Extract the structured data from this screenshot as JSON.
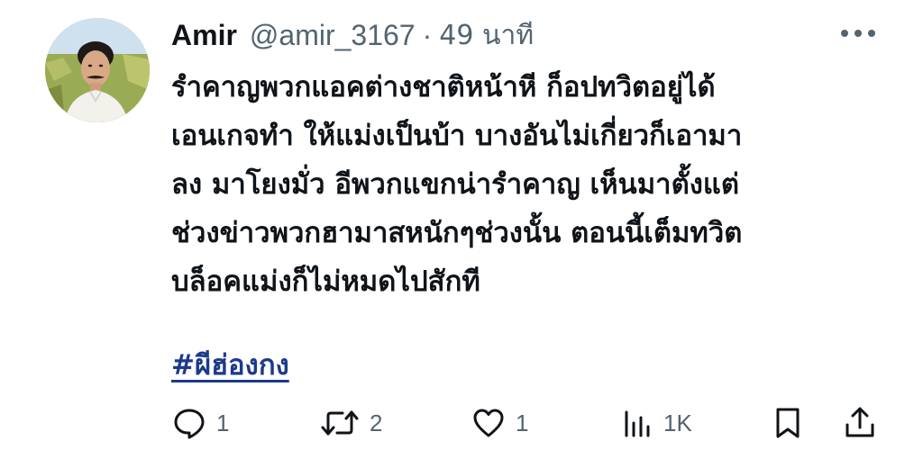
{
  "tweet": {
    "display_name": "Amir",
    "handle": "@amir_3167",
    "separator": "·",
    "time": "49 นาที",
    "text_lines": [
      "รำคาญพวกแอคต่างชาติหน้าหี ก็อปทวิตอยู่ได้",
      "เอนเกจทำ ให้แม่งเป็นบ้า บางอันไม่เกี่ยวก็เอามา",
      "ลง มาโยงมั่ว อีพวกแขกน่ารำคาญ เห็นมาตั้งแต่",
      "ช่วงข่าวพวกฮามาสหนักๆช่วงนั้น ตอนนี้เต็มทวิต",
      "บล็อคแม่งก็ไม่หมดไปสักที"
    ],
    "hashtag": "#ผีฮ่องกง"
  },
  "actions": {
    "reply": {
      "icon": "reply-icon",
      "count": "1"
    },
    "retweet": {
      "icon": "retweet-icon",
      "count": "2"
    },
    "like": {
      "icon": "heart-icon",
      "count": "1"
    },
    "views": {
      "icon": "views-icon",
      "count": "1K"
    },
    "bookmark": {
      "icon": "bookmark-icon"
    },
    "share": {
      "icon": "share-icon"
    }
  },
  "colors": {
    "text": "#0f1419",
    "secondary": "#536471",
    "hashtag": "#1d3a8a",
    "background": "#ffffff"
  }
}
